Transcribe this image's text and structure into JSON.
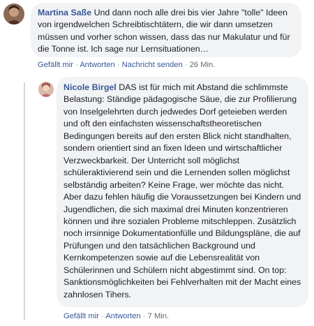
{
  "comments": [
    {
      "author": "Martina Saße",
      "text": "Und dann noch alle drei bis vier Jahre \"tolle\" Ideen von irgendwelchen Schreibtischtätern, die wir dann umsetzen müssen und vorher schon wissen, dass das nur Makulatur und für die Tonne ist. Ich sage nur Lernsituationen…",
      "actions": {
        "like": "Gefällt mir",
        "reply": "Antworten",
        "message": "Nachricht senden",
        "time": "26 Min."
      }
    },
    {
      "author": "Nicole Birgel",
      "text": "DAS ist für mich mit Abstand die schlimmste Belastung: Ständige pädagogische Säue, die zur Profilierung von Inselgelehrten durch jedwedes Dorf geteieben werden und oft den einfachsten wissenschaftstheoretischen Bedingungen bereits auf den ersten Blick nicht standhalten, sondern orientiert sind an fixen Ideen und wirtschaftlicher Verzweckbarkeit. Der Unterricht soll möglichst schüleraktivierend sein und die Lernenden sollen möglichst selbständig arbeiten? Keine Frage, wer möchte das nicht. Aber dazu fehlen häufig die Voraussetzungen bei Kindern und Jugendlichen, die sich maximal drei Minuten konzentrieren können und ihre sozialen Probleme mitschleppen. Zusätzlich noch irrsinnige Dokumentationfülle und Bildungspläne, die auf Prüfungen und den tatsächlichen Background und Kernkompetenzen sowie auf die Lebensrealität von Schülerinnen und Schülern nicht abgestimmt sind. On top: Sanktionsmöglichkeiten bei Fehlverhalten mit der Macht eines zahnlosen Tihers.",
      "actions": {
        "like": "Gefällt mir",
        "reply": "Antworten",
        "time": "7 Min."
      }
    }
  ]
}
